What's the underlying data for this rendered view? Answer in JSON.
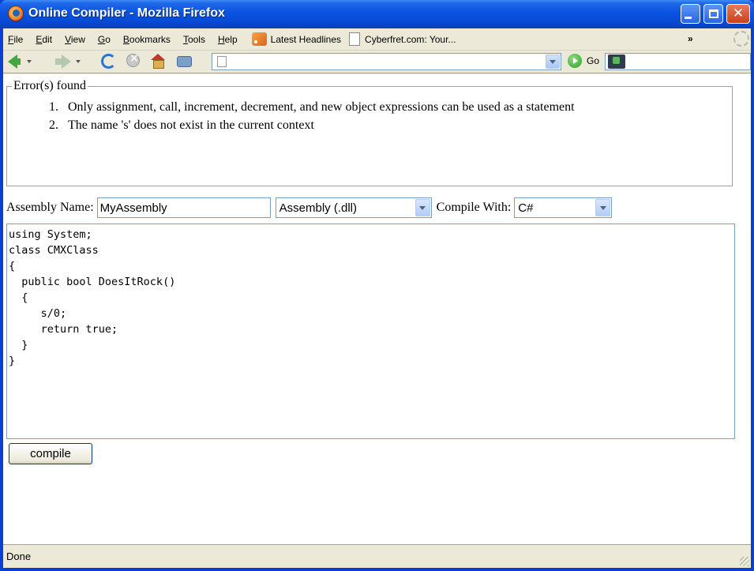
{
  "window": {
    "title": "Online Compiler - Mozilla Firefox"
  },
  "menubar": {
    "items": [
      {
        "label": "File",
        "mnemonic": "F"
      },
      {
        "label": "Edit",
        "mnemonic": "E"
      },
      {
        "label": "View",
        "mnemonic": "V"
      },
      {
        "label": "Go",
        "mnemonic": "G"
      },
      {
        "label": "Bookmarks",
        "mnemonic": "B"
      },
      {
        "label": "Tools",
        "mnemonic": "T"
      },
      {
        "label": "Help",
        "mnemonic": "H"
      }
    ],
    "bookmarks": [
      {
        "label": "Latest Headlines",
        "icon": "rss-feed-icon"
      },
      {
        "label": "Cyberfret.com: Your...",
        "icon": "page-icon"
      }
    ],
    "overflow_label": "»"
  },
  "navbar": {
    "url_value": "",
    "go_label": "Go",
    "search_value": ""
  },
  "errors": {
    "legend": "Error(s) found",
    "items": [
      {
        "num": "1.",
        "text": "Only assignment, call, increment, decrement, and new object expressions can be used as a statement"
      },
      {
        "num": "2.",
        "text": "The name 's' does not exist in the current context"
      }
    ]
  },
  "options": {
    "assembly_name_label": "Assembly Name:",
    "assembly_name_value": "MyAssembly",
    "assembly_type_value": "Assembly (.dll)",
    "compile_with_label": "Compile With:",
    "compile_with_value": "C#"
  },
  "code": "using System;\nclass CMXClass\n{\n  public bool DoesItRock()\n  {\n     s/0;\n     return true;\n  }\n}",
  "compile_button_label": "compile",
  "status": {
    "text": "Done"
  }
}
